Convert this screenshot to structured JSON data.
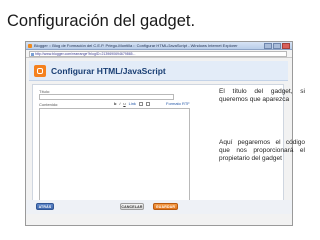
{
  "slide": {
    "title": "Configuración del gadget."
  },
  "window": {
    "title": "Blogger :: Blog de Formación del C.E.P. Priego-Montilla :: Configurar HTML/JavaScript - Windows Internet Explorer",
    "url": "http://www.blogger.com/rearrange?blogID=2139690694679865..."
  },
  "gadget": {
    "brand_icon": "blogger-logo-icon",
    "header_title": "Configurar HTML/JavaScript",
    "title_label": "Título:",
    "content_label": "Contenido:",
    "toolbar": {
      "bold": "b",
      "italic": "i",
      "underline": "u",
      "link": "Link",
      "rich_format": "Formato RTF"
    },
    "buttons": {
      "back": "ATRÁS",
      "cancel": "CANCELAR",
      "save": "GUARDAR"
    }
  },
  "notes": {
    "title_note": "El título del gadget, si queremos que aparezca",
    "content_note": "Aquí pegaremos el código que nos proporcionará el propietario del gadget"
  },
  "colors": {
    "brand_orange": "#f4811f",
    "header_blue": "#1a3f74",
    "save_orange": "#e0741c",
    "back_blue": "#3f68ad"
  }
}
